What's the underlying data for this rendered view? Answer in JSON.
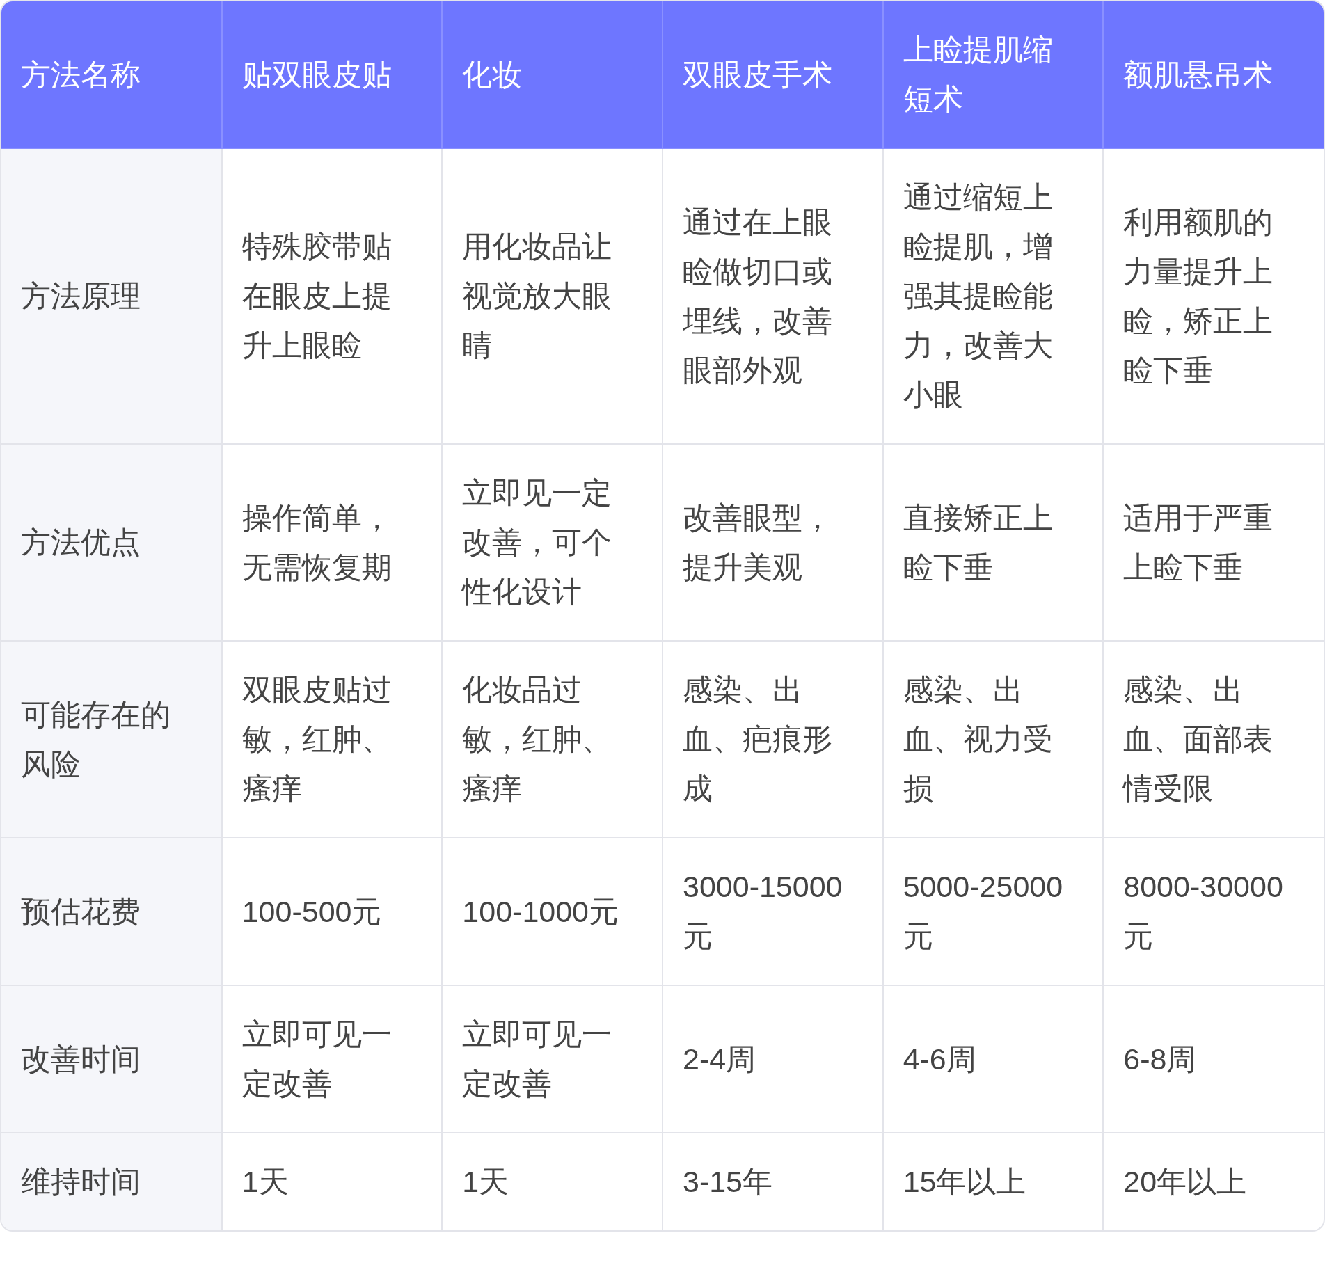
{
  "table": {
    "columns": [
      "方法名称",
      "贴双眼皮贴",
      "化妆",
      "双眼皮手术",
      "上睑提肌缩短术",
      "额肌悬吊术"
    ],
    "rows": [
      {
        "cells": [
          "方法原理",
          "特殊胶带贴在眼皮上提升上眼睑",
          "用化妆品让视觉放大眼睛",
          "通过在上眼睑做切口或埋线，改善眼部外观",
          "通过缩短上睑提肌，增强其提睑能力，改善大小眼",
          "利用额肌的力量提升上睑，矫正上睑下垂"
        ]
      },
      {
        "cells": [
          "方法优点",
          "操作简单，无需恢复期",
          "立即见一定改善，可个性化设计",
          "改善眼型，提升美观",
          "直接矫正上睑下垂",
          "适用于严重上睑下垂"
        ]
      },
      {
        "cells": [
          "可能存在的风险",
          "双眼皮贴过敏，红肿、瘙痒",
          "化妆品过敏，红肿、瘙痒",
          "感染、出血、疤痕形成",
          "感染、出血、视力受损",
          "感染、出血、面部表情受限"
        ]
      },
      {
        "cells": [
          "预估花费",
          "100-500元",
          "100-1000元",
          "3000-15000元",
          "5000-25000元",
          "8000-30000元"
        ]
      },
      {
        "cells": [
          "改善时间",
          "立即可见一定改善",
          "立即可见一定改善",
          "2-4周",
          "4-6周",
          "6-8周"
        ]
      },
      {
        "cells": [
          "维持时间",
          "1天",
          "1天",
          "3-15年",
          "15年以上",
          "20年以上"
        ]
      }
    ]
  }
}
